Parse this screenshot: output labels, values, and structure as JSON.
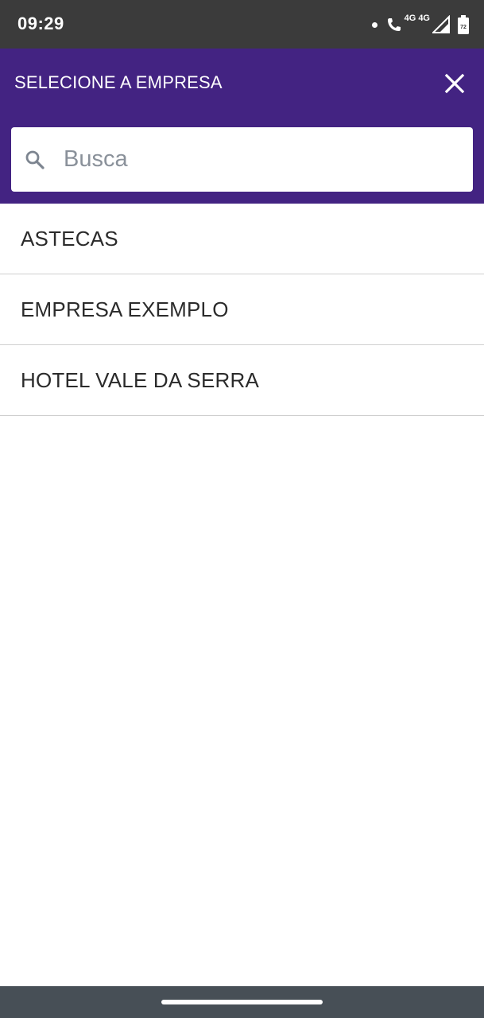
{
  "status_bar": {
    "time": "09:29",
    "network_label": "4G",
    "network_label_2": "4G",
    "battery_level": "72",
    "icons": [
      "notification-dot-icon",
      "wifi-call-icon",
      "signal-icon",
      "battery-icon"
    ]
  },
  "header": {
    "title": "SELECIONE A EMPRESA",
    "close_icon": "close-icon",
    "background_color": "#432382"
  },
  "search": {
    "placeholder": "Busca",
    "value": "",
    "icon": "search-icon"
  },
  "companies": [
    {
      "label": "ASTECAS"
    },
    {
      "label": "EMPRESA EXEMPLO"
    },
    {
      "label": "HOTEL VALE DA SERRA"
    }
  ]
}
